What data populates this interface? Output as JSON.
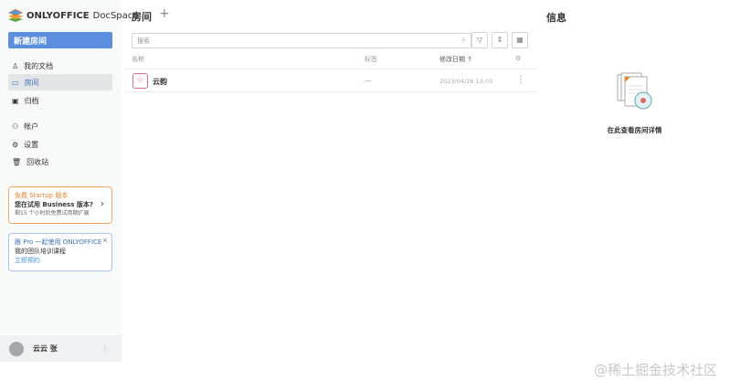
{
  "brand": {
    "logo_bold": "ONLYOFFICE",
    "logo_thin": "DocSpace"
  },
  "sidebar": {
    "new_room": "新建房间",
    "items": [
      {
        "label": "我的文档",
        "icon": "user-icon"
      },
      {
        "label": "房间",
        "icon": "folder-icon"
      },
      {
        "label": "归档",
        "icon": "archive-icon"
      },
      {
        "label": "帐户",
        "icon": "people-icon"
      },
      {
        "label": "设置",
        "icon": "gear-icon"
      },
      {
        "label": "回收站",
        "icon": "trash-icon"
      }
    ],
    "promo": {
      "title": "免费 Startup 版本",
      "headline": "您在试用 Business 版本?",
      "text": "剩15 个小时后免费试用期扩展"
    },
    "training": {
      "title": "跟 Pro 一起使用 ONLYOFFICE",
      "text": "我的团队培训课程",
      "link": "立即预约"
    },
    "user": {
      "name": "云云 张"
    }
  },
  "main": {
    "title": "房间",
    "search_placeholder": "搜索",
    "columns": {
      "name": "名称",
      "tags": "标签",
      "modified": "修改日期"
    },
    "rows": [
      {
        "name": "云韵",
        "tags": "—",
        "modified": "2023/04/26 13:03"
      }
    ]
  },
  "info": {
    "title": "信息",
    "empty_text": "在此查看房间详情"
  },
  "watermark": "@稀土掘金技术社区",
  "colors": {
    "accent": "#5b8edc",
    "room": "#e06a8f",
    "promo": "#f3a868"
  }
}
